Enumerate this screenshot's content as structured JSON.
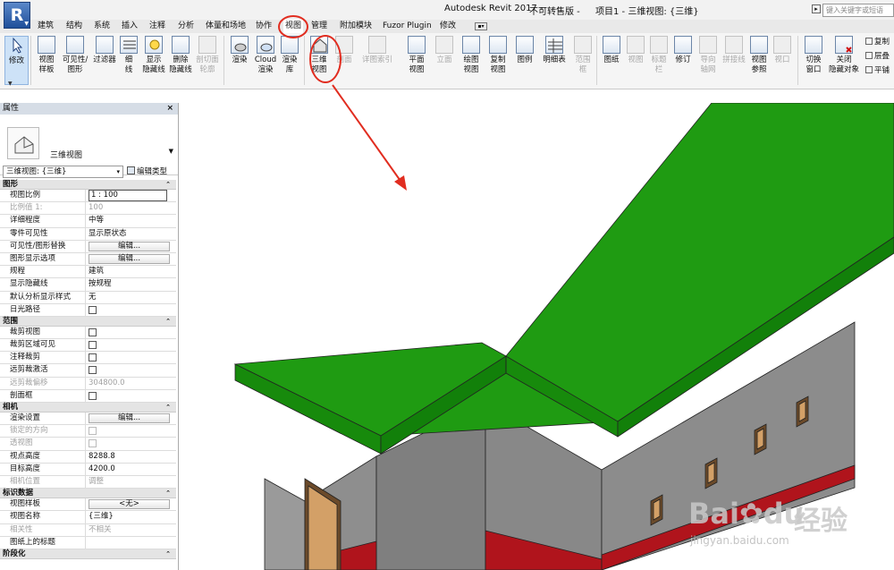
{
  "app": {
    "logo_letter": "R",
    "title": "Autodesk Revit 2017 -",
    "edition": "不可转售版 -",
    "project": "项目1 - 三维视图: {三维}",
    "search_placeholder": "键入关键字或短语"
  },
  "tabs": [
    "建筑",
    "结构",
    "系统",
    "插入",
    "注释",
    "分析",
    "体量和场地",
    "协作",
    "视图",
    "管理",
    "附加模块",
    "Fuzor Plugin",
    "修改"
  ],
  "active_tab": "视图",
  "ribbon": {
    "modify": "修改",
    "view_template": [
      "视图",
      "样板"
    ],
    "visibility": [
      "可见性/",
      "图形"
    ],
    "filters": "过滤器",
    "thin_lines": [
      "细",
      "线"
    ],
    "show_hidden": [
      "显示",
      "隐藏线"
    ],
    "remove_hidden": [
      "删除",
      "隐藏线"
    ],
    "cut_profile": [
      "剖切面",
      "轮廓"
    ],
    "render": "渲染",
    "cloud_render": [
      "Cloud",
      "渲染"
    ],
    "render_gallery": [
      "渲染",
      "库"
    ],
    "view_3d": [
      "三维",
      "视图"
    ],
    "section": "剖面",
    "callout": "详图索引",
    "plan_views": [
      "平面",
      "视图"
    ],
    "elevation": "立面",
    "drafting_view": [
      "绘图",
      "视图"
    ],
    "duplicate_view": [
      "复制",
      "视图"
    ],
    "legends": "图例",
    "schedules": "明细表",
    "scope_box": [
      "范围",
      "框"
    ],
    "sheet": "图纸",
    "view": "视图",
    "title_block": [
      "标题",
      "栏"
    ],
    "revisions": "修订",
    "guide_grid": [
      "导向",
      "轴网"
    ],
    "matchline": "拼接线",
    "view_reference": [
      "视图",
      "参照"
    ],
    "viewports": [
      "视口"
    ],
    "switch_windows": [
      "切换",
      "窗口"
    ],
    "close_hidden": [
      "关闭",
      "隐藏对象"
    ],
    "replicate": "复制",
    "cascade": "层叠",
    "tile": "平铺"
  },
  "properties": {
    "panel_title": "属性",
    "close": "×",
    "type_name": "三维视图",
    "selector": "三维视图: {三维}",
    "edit_type": "编辑类型",
    "sections": [
      {
        "name": "图形",
        "rows": [
          {
            "k": "视图比例",
            "v": "1 : 100",
            "kind": "input"
          },
          {
            "k": "比例值 1:",
            "v": "100",
            "kind": "text",
            "disabled": true
          },
          {
            "k": "详细程度",
            "v": "中等",
            "kind": "text"
          },
          {
            "k": "零件可见性",
            "v": "显示原状态",
            "kind": "text"
          },
          {
            "k": "可见性/图形替换",
            "v": "编辑...",
            "kind": "button"
          },
          {
            "k": "图形显示选项",
            "v": "编辑...",
            "kind": "button"
          },
          {
            "k": "规程",
            "v": "建筑",
            "kind": "text"
          },
          {
            "k": "显示隐藏线",
            "v": "按规程",
            "kind": "text"
          },
          {
            "k": "默认分析显示样式",
            "v": "无",
            "kind": "text"
          },
          {
            "k": "日光路径",
            "v": false,
            "kind": "check"
          }
        ]
      },
      {
        "name": "范围",
        "rows": [
          {
            "k": "裁剪视图",
            "v": false,
            "kind": "check"
          },
          {
            "k": "裁剪区域可见",
            "v": false,
            "kind": "check"
          },
          {
            "k": "注释裁剪",
            "v": false,
            "kind": "check"
          },
          {
            "k": "远剪裁激活",
            "v": false,
            "kind": "check"
          },
          {
            "k": "远剪裁偏移",
            "v": "304800.0",
            "kind": "text",
            "disabled": true
          },
          {
            "k": "剖面框",
            "v": false,
            "kind": "check"
          }
        ]
      },
      {
        "name": "相机",
        "rows": [
          {
            "k": "渲染设置",
            "v": "编辑...",
            "kind": "button"
          },
          {
            "k": "锁定的方向",
            "v": false,
            "kind": "check",
            "disabled": true
          },
          {
            "k": "透视图",
            "v": false,
            "kind": "check",
            "disabled": true
          },
          {
            "k": "视点高度",
            "v": "8288.8",
            "kind": "text"
          },
          {
            "k": "目标高度",
            "v": "4200.0",
            "kind": "text"
          },
          {
            "k": "相机位置",
            "v": "调整",
            "kind": "text",
            "disabled": true
          }
        ]
      },
      {
        "name": "标识数据",
        "rows": [
          {
            "k": "视图样板",
            "v": "<无>",
            "kind": "button"
          },
          {
            "k": "视图名称",
            "v": "{三维}",
            "kind": "text"
          },
          {
            "k": "相关性",
            "v": "不相关",
            "kind": "text",
            "disabled": true
          },
          {
            "k": "图纸上的标题",
            "v": "",
            "kind": "text"
          }
        ]
      },
      {
        "name": "阶段化",
        "rows": []
      }
    ]
  },
  "watermark": {
    "brand": "Bai",
    "brand2": "du",
    "cn": "经验",
    "url": "jingyan.baidu.com"
  },
  "colors": {
    "roof": "#1f9b12",
    "wall": "#8c8c8c",
    "base": "#b0141c",
    "door": "#d3a067",
    "annotation": "#e12d20",
    "accent": "#1f5ca8"
  }
}
